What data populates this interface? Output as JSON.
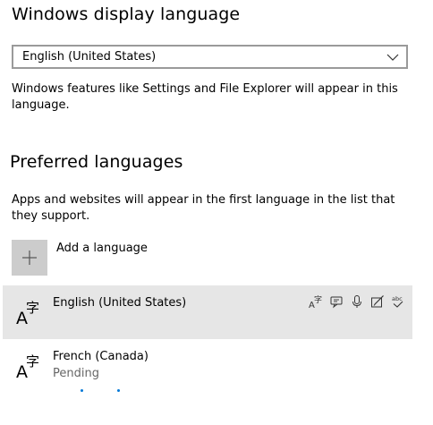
{
  "display_language": {
    "title": "Windows display language",
    "selected": "English (United States)",
    "description": "Windows features like Settings and File Explorer will appear in this language."
  },
  "preferred_languages": {
    "title": "Preferred languages",
    "description": "Apps and websites will appear in the first language in the list that they support.",
    "add_label": "Add a language",
    "items": [
      {
        "name": "English (United States)",
        "status": "",
        "feature_icons": [
          "display-language-icon",
          "speech-icon",
          "voice-microphone-icon",
          "handwriting-icon",
          "spell-check-icon"
        ]
      },
      {
        "name": "French (Canada)",
        "status": "Pending"
      }
    ]
  },
  "colors": {
    "selected_row": "#e6e6e6",
    "add_tile": "#cccccc",
    "accent": "#0078d7",
    "border": "#9a9a9a",
    "secondary_text": "#666666"
  }
}
